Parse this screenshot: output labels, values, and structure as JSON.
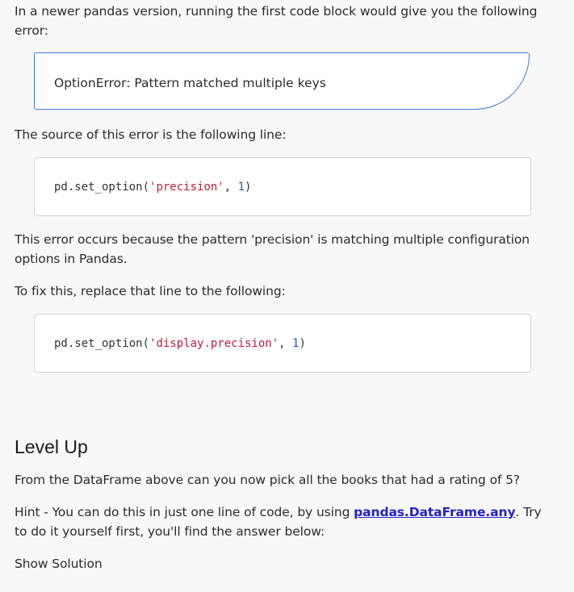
{
  "intro": {
    "text": "In a newer pandas version, running the first code block would give you the following error:"
  },
  "error_box": {
    "message": "OptionError: Pattern matched multiple keys"
  },
  "source_text": "The source of this error is the following line:",
  "code1": {
    "func": "pd.set_option(",
    "arg_string": "'precision'",
    "sep": ", ",
    "arg_number": "1",
    "close": ")"
  },
  "explanation": "This error occurs because the pattern 'precision' is matching multiple configuration options in Pandas.",
  "fix_text": "To fix this, replace that line to the following:",
  "code2": {
    "func": "pd.set_option(",
    "arg_string": "'display.precision'",
    "sep": ", ",
    "arg_number": "1",
    "close": ")"
  },
  "level_up": {
    "heading": "Level Up",
    "question": "From the DataFrame above can you now pick all the books that had a rating of 5?",
    "hint_prefix": "Hint - You can do this in just one line of code, by using ",
    "hint_link": "pandas.DataFrame.any",
    "hint_suffix": ". Try to do it yourself first, you'll find the answer below:",
    "show_solution": "Show Solution"
  },
  "colors": {
    "error_border": "#3f7bd8",
    "string_token": "#c41a3a",
    "number_token": "#1c5fb8",
    "link": "#2222cc"
  }
}
